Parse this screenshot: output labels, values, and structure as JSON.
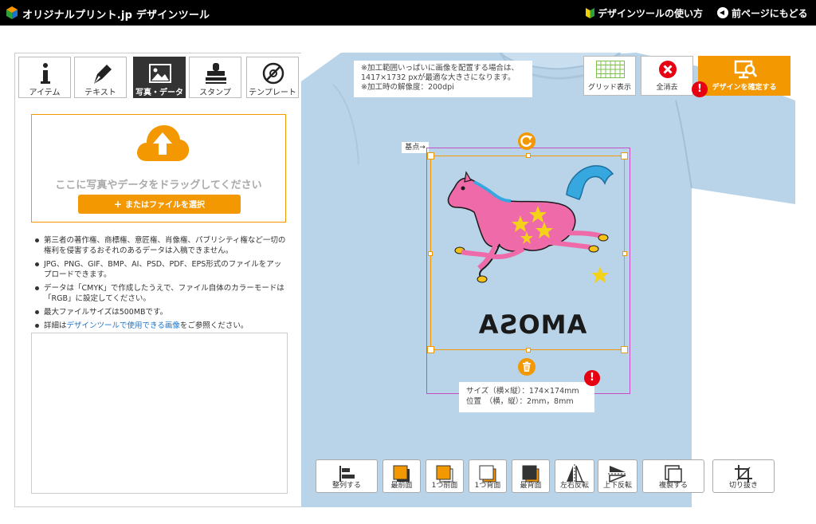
{
  "header": {
    "brand": "オリジナルプリント.jp デザインツール",
    "guide_link": "デザインツールの使い方",
    "back_link": "前ページにもどる"
  },
  "tabs": [
    {
      "label": "アイテム",
      "icon": "info-icon"
    },
    {
      "label": "テキスト",
      "icon": "pen-icon"
    },
    {
      "label": "写真・データ",
      "icon": "image-icon",
      "active": true
    },
    {
      "label": "スタンプ",
      "icon": "stamp-icon"
    },
    {
      "label": "テンプレート",
      "icon": "template-icon"
    }
  ],
  "upload": {
    "drop_text": "ここに写真やデータをドラッグしてください",
    "file_button": "またはファイルを選択",
    "notes": [
      "第三者の著作権、商標権、意匠権、肖像権、パブリシティ権など一切の権利を侵害するおそれのあるデータは入稿できません。",
      "JPG、PNG、GIF、BMP、AI、PSD、PDF、EPS形式のファイルをアップロードできます。",
      "データは「CMYK」で作成したうえで、ファイル自体のカラーモードは「RGB」に設定してください。",
      "最大ファイルサイズは500MBです。"
    ],
    "note_detail_prefix": "詳細は",
    "note_detail_link": "デザインツールで使用できる画像",
    "note_detail_suffix": "をご参照ください。"
  },
  "canvas": {
    "info_line1": "※加工範囲いっぱいに画像を配置する場合は、",
    "info_line2": "1417×1732 pxが最適な大きさになります。",
    "info_line3": "※加工時の解像度：200dpi",
    "basepoint_label": "基点→",
    "artwork_text": "AMOSA",
    "size_line1": "サイズ（横×縦）：174×174mm",
    "size_line2": "位置　（横，縦）：2mm，8mm",
    "shirt_color": "#b9d4e8",
    "accent_color": "#f39800"
  },
  "toolbar": {
    "grid": "グリッド表示",
    "clear_all": "全消去",
    "confirm": "デザインを確定する"
  },
  "bottom_tools": [
    {
      "label": "整列する",
      "icon": "align-icon"
    },
    {
      "label": "最前面",
      "icon": "bring-to-front-icon"
    },
    {
      "label": "1つ前面",
      "icon": "bring-forward-icon"
    },
    {
      "label": "1つ背面",
      "icon": "send-backward-icon"
    },
    {
      "label": "最背面",
      "icon": "send-to-back-icon"
    },
    {
      "label": "左右反転",
      "icon": "flip-horizontal-icon"
    },
    {
      "label": "上下反転",
      "icon": "flip-vertical-icon"
    },
    {
      "label": "複製する",
      "icon": "duplicate-icon"
    },
    {
      "label": "切り抜き",
      "icon": "crop-icon"
    }
  ]
}
